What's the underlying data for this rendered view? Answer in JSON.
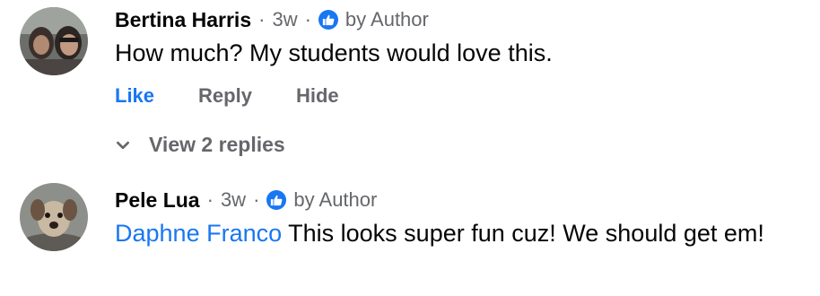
{
  "comments": [
    {
      "author": "Bertina Harris",
      "time": "3w",
      "author_badge_icon": "thumbs-up-icon",
      "author_badge_label": "by Author",
      "mention": "",
      "text": "How much? My students would love this.",
      "actions": {
        "like": "Like",
        "reply": "Reply",
        "hide": "Hide"
      },
      "replies_link": "View 2 replies"
    },
    {
      "author": "Pele Lua",
      "time": "3w",
      "author_badge_icon": "thumbs-up-icon",
      "author_badge_label": "by Author",
      "mention": "Daphne Franco",
      "text": "This looks super fun cuz! We should get em!"
    }
  ],
  "colors": {
    "accent": "#1877f2",
    "secondary_text": "#65676b",
    "primary_text": "#050505"
  }
}
